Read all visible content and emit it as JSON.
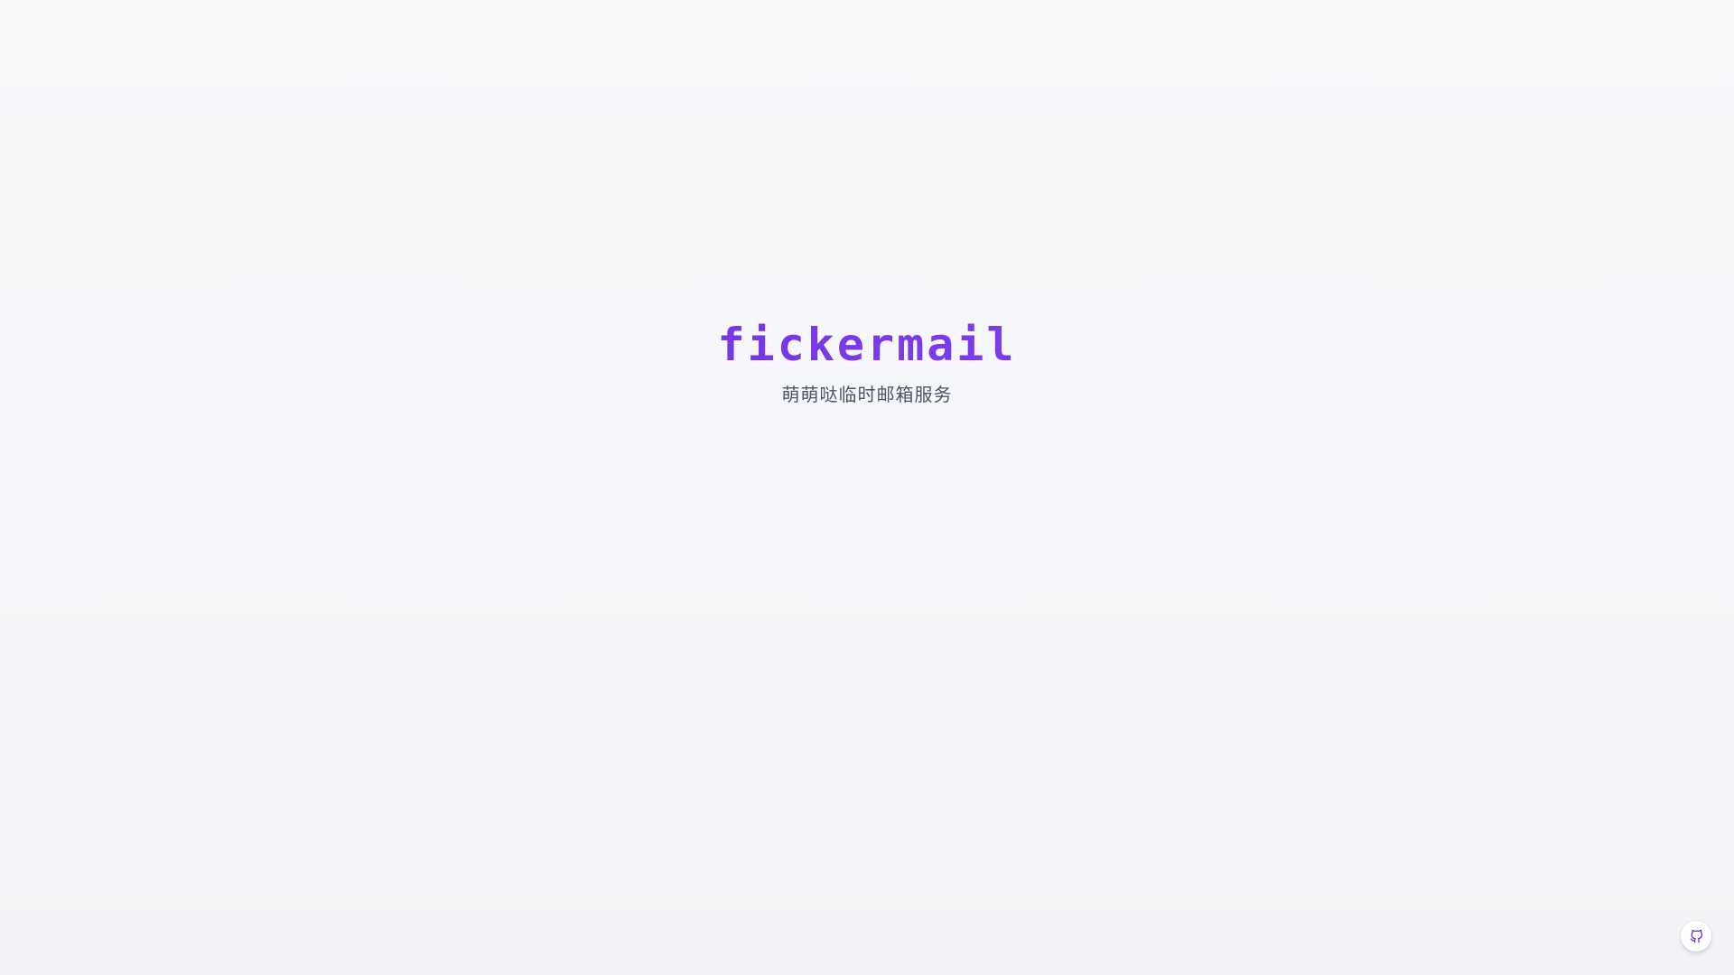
{
  "brand": {
    "name": "fickermail",
    "tagline": "萌萌哒临时邮箱服务",
    "gradient_start": "#6d28d9",
    "gradient_end": "#9333ea"
  },
  "footer": {
    "github_button": {
      "icon": "github-icon",
      "color": "#6d28d9"
    }
  }
}
